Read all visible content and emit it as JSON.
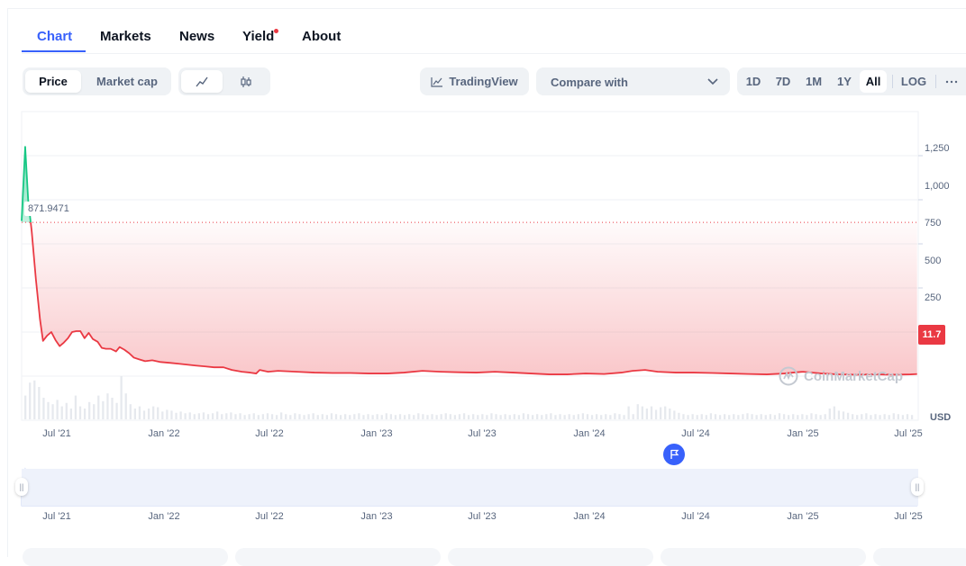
{
  "tabs": [
    {
      "label": "Chart",
      "active": true
    },
    {
      "label": "Markets",
      "active": false
    },
    {
      "label": "News",
      "active": false
    },
    {
      "label": "Yield",
      "active": false,
      "dot": true
    },
    {
      "label": "About",
      "active": false
    }
  ],
  "toolbar": {
    "price_label": "Price",
    "marketcap_label": "Market cap",
    "line_icon": "line-chart-icon",
    "candle_icon": "candlestick-icon",
    "tradingview_label": "TradingView",
    "compare_label": "Compare with",
    "ranges": [
      "1D",
      "7D",
      "1M",
      "1Y",
      "All"
    ],
    "selected_range": "All",
    "log_label": "LOG",
    "more_icon": "more-icon"
  },
  "chart_data": {
    "type": "area",
    "y_axis_ticks": [
      "1,250",
      "1,000",
      "750",
      "500",
      "250"
    ],
    "ylim": [
      -250,
      1500
    ],
    "x_axis_ticks": [
      "Jul '21",
      "Jan '22",
      "Jul '22",
      "Jan '23",
      "Jul '23",
      "Jan '24",
      "Jul '24",
      "Jan '25",
      "Jul '25"
    ],
    "currency_label": "USD",
    "reference_price": "871.9471",
    "reference_value": 871.9471,
    "current_price": "11.7",
    "current_value": 11.7,
    "watermark": "CoinMarketCap",
    "colors": {
      "up": "#16c784",
      "down": "#ea3943",
      "navigator": "#3861fb"
    },
    "series": [
      {
        "x": [
          "2021-05-26",
          "2021-06-01",
          "2021-06-06",
          "2021-06-12",
          "2021-06-19",
          "2021-06-26",
          "2021-07-01",
          "2021-07-08",
          "2021-07-15",
          "2021-07-22",
          "2021-07-29",
          "2021-08-05",
          "2021-08-12",
          "2021-08-19",
          "2021-08-26",
          "2021-09-02",
          "2021-09-09",
          "2021-09-16",
          "2021-09-23",
          "2021-10-01",
          "2021-10-08",
          "2021-10-15",
          "2021-10-23",
          "2021-11-01",
          "2021-11-07",
          "2021-11-15",
          "2021-11-23",
          "2021-12-01",
          "2021-12-10",
          "2021-12-20",
          "2022-01-01",
          "2022-01-15",
          "2022-02-01",
          "2022-02-15",
          "2022-03-01",
          "2022-03-15",
          "2022-04-01",
          "2022-04-15",
          "2022-05-01",
          "2022-05-15",
          "2022-06-01",
          "2022-06-15",
          "2022-06-25",
          "2022-07-01",
          "2022-07-15",
          "2022-08-01",
          "2022-09-01",
          "2022-10-01",
          "2022-11-01",
          "2022-12-01",
          "2023-01-01",
          "2023-02-01",
          "2023-03-01",
          "2023-04-01",
          "2023-05-01",
          "2023-06-01",
          "2023-07-01",
          "2023-08-01",
          "2023-09-01",
          "2023-10-01",
          "2023-11-01",
          "2023-12-01",
          "2024-01-01",
          "2024-02-01",
          "2024-03-01",
          "2024-03-20",
          "2024-04-10",
          "2024-05-01",
          "2024-06-01",
          "2024-07-01",
          "2024-08-01",
          "2024-09-01",
          "2024-10-01",
          "2024-11-01",
          "2024-12-01",
          "2024-12-15",
          "2025-01-01",
          "2025-02-01",
          "2025-03-01",
          "2025-04-01",
          "2025-05-01",
          "2025-06-01",
          "2025-07-01",
          "2025-07-12"
        ],
        "y": [
          880,
          1300,
          1000,
          820,
          550,
          320,
          200,
          230,
          250,
          205,
          170,
          190,
          215,
          250,
          255,
          255,
          215,
          245,
          210,
          195,
          160,
          155,
          155,
          140,
          165,
          150,
          130,
          105,
          95,
          85,
          90,
          80,
          75,
          70,
          65,
          60,
          55,
          50,
          50,
          35,
          25,
          20,
          15,
          35,
          25,
          30,
          25,
          20,
          18,
          18,
          15,
          15,
          20,
          30,
          25,
          22,
          20,
          25,
          20,
          15,
          10,
          10,
          15,
          12,
          20,
          30,
          35,
          25,
          20,
          20,
          18,
          15,
          12,
          10,
          15,
          20,
          25,
          15,
          10,
          8,
          10,
          8,
          10,
          11.7
        ]
      }
    ],
    "volume": [
      0.55,
      0.85,
      0.9,
      0.75,
      0.5,
      0.4,
      0.35,
      0.45,
      0.3,
      0.38,
      0.25,
      0.55,
      0.3,
      0.25,
      0.4,
      0.35,
      0.55,
      0.42,
      0.6,
      0.5,
      0.38,
      1.0,
      0.6,
      0.35,
      0.25,
      0.3,
      0.2,
      0.25,
      0.3,
      0.28,
      0.18,
      0.22,
      0.2,
      0.15,
      0.18,
      0.14,
      0.16,
      0.12,
      0.14,
      0.16,
      0.12,
      0.14,
      0.18,
      0.12,
      0.14,
      0.16,
      0.12,
      0.14,
      0.1,
      0.12,
      0.14,
      0.1,
      0.12,
      0.14,
      0.12,
      0.1,
      0.16,
      0.12,
      0.1,
      0.14,
      0.12,
      0.1,
      0.12,
      0.14,
      0.1,
      0.12,
      0.1,
      0.14,
      0.12,
      0.1,
      0.12,
      0.1,
      0.12,
      0.14,
      0.1,
      0.12,
      0.1,
      0.12,
      0.1,
      0.14,
      0.12,
      0.1,
      0.12,
      0.1,
      0.12,
      0.1,
      0.14,
      0.12,
      0.1,
      0.12,
      0.1,
      0.12,
      0.14,
      0.12,
      0.1,
      0.12,
      0.14,
      0.1,
      0.12,
      0.1,
      0.12,
      0.1,
      0.14,
      0.12,
      0.1,
      0.12,
      0.1,
      0.12,
      0.1,
      0.14,
      0.12,
      0.1,
      0.12,
      0.1,
      0.12,
      0.14,
      0.1,
      0.12,
      0.1,
      0.12,
      0.1,
      0.12,
      0.14,
      0.12,
      0.1,
      0.12,
      0.1,
      0.12,
      0.1,
      0.14,
      0.12,
      0.1,
      0.3,
      0.12,
      0.35,
      0.3,
      0.25,
      0.3,
      0.22,
      0.28,
      0.3,
      0.25,
      0.2,
      0.15,
      0.12,
      0.1,
      0.12,
      0.1,
      0.12,
      0.1,
      0.14,
      0.12,
      0.1,
      0.12,
      0.1,
      0.12,
      0.1,
      0.12,
      0.14,
      0.12,
      0.1,
      0.12,
      0.1,
      0.12,
      0.1,
      0.14,
      0.12,
      0.1,
      0.12,
      0.1,
      0.12,
      0.1,
      0.14,
      0.12,
      0.1,
      0.12,
      0.25,
      0.3,
      0.2,
      0.18,
      0.15,
      0.12,
      0.1,
      0.12,
      0.14,
      0.1,
      0.12,
      0.1,
      0.12,
      0.1,
      0.14,
      0.12,
      0.1,
      0.12,
      0.1
    ]
  },
  "navigator": {
    "x_axis_ticks": [
      "Jul '21",
      "Jan '22",
      "Jul '22",
      "Jan '23",
      "Jul '23",
      "Jan '24",
      "Jul '24",
      "Jan '25",
      "Jul '25"
    ],
    "left_handle": "||",
    "right_handle": "||"
  }
}
